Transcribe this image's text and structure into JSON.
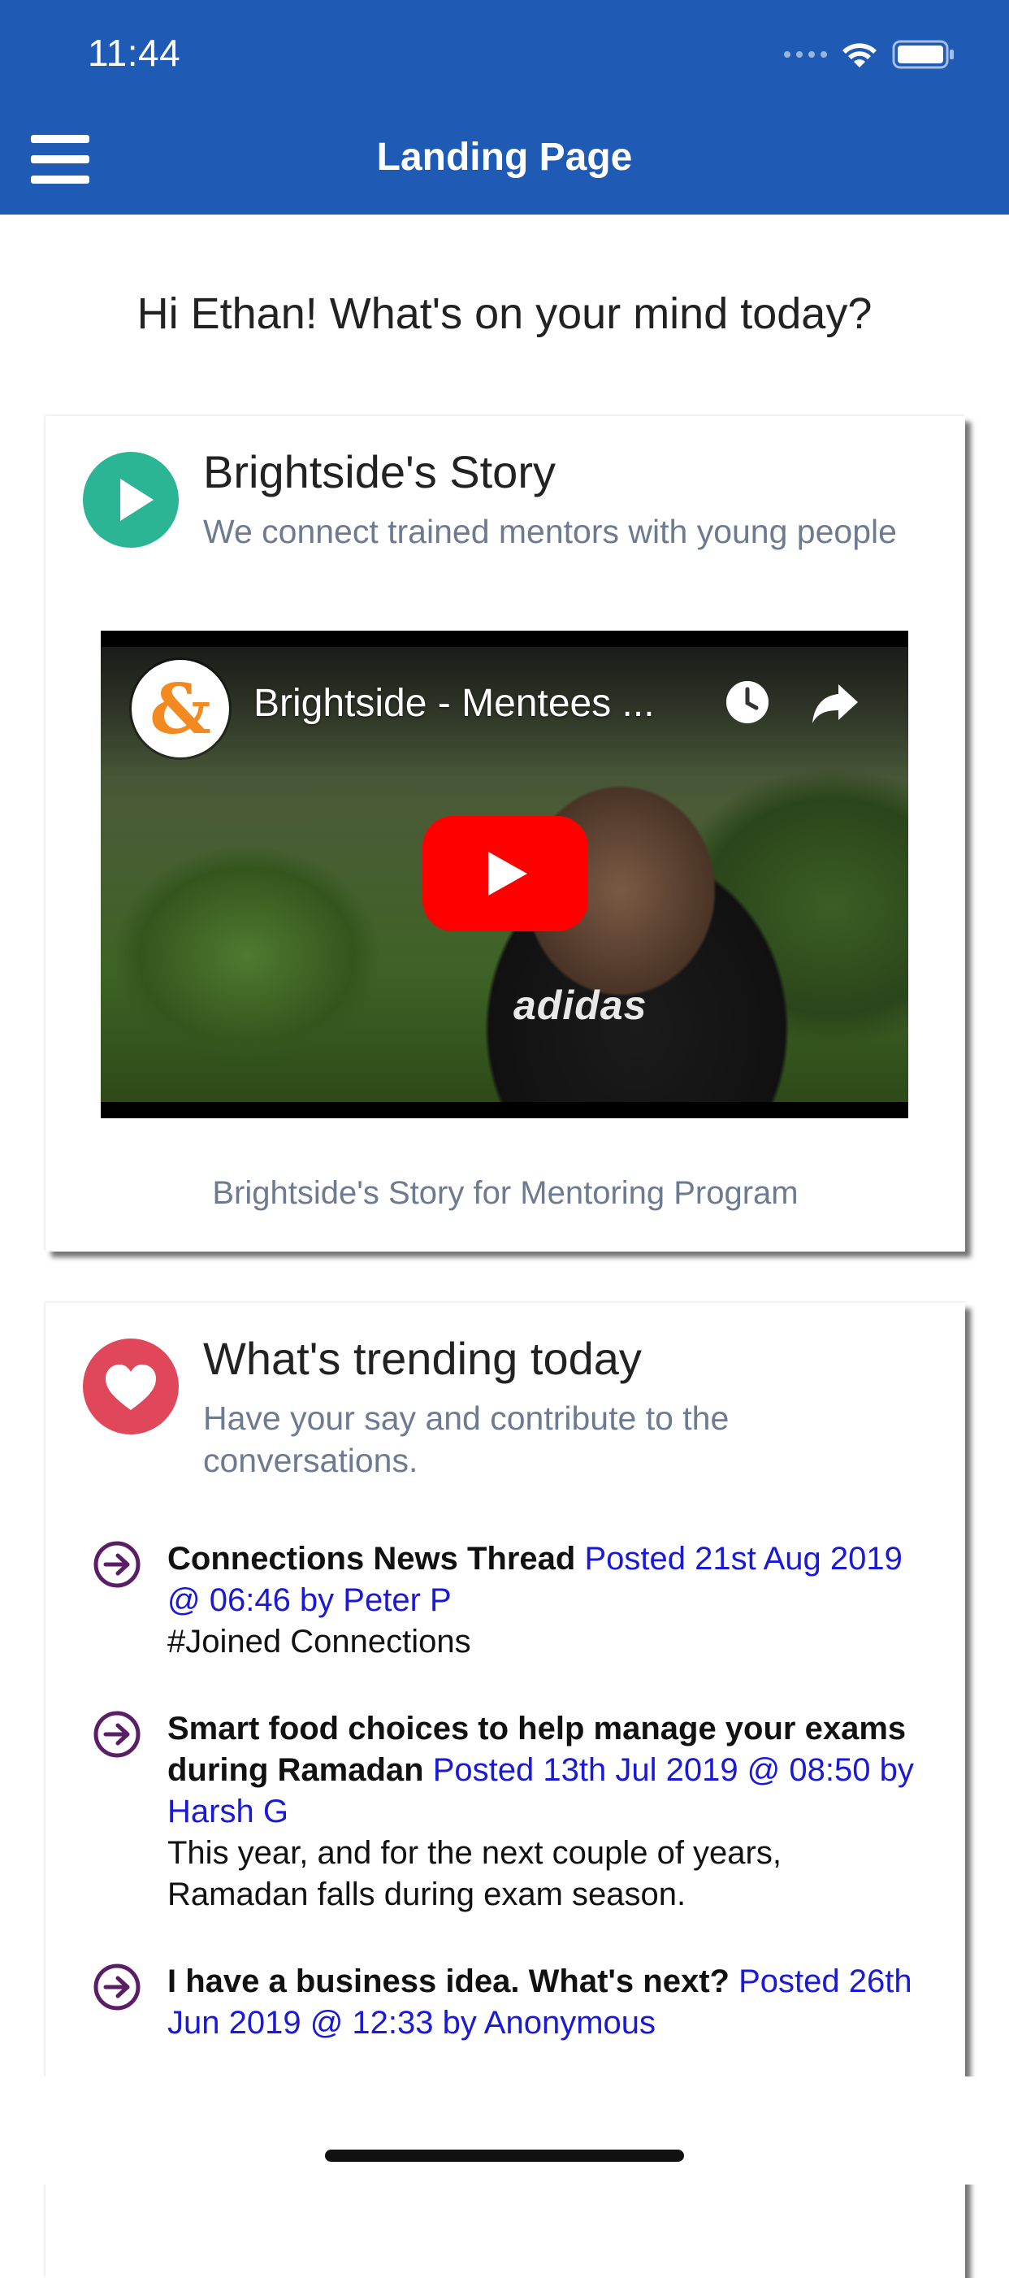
{
  "status_bar": {
    "time": "11:44"
  },
  "header": {
    "title": "Landing Page",
    "menu_icon": "hamburger-menu-icon",
    "background": "#1f5bb4"
  },
  "greeting": "Hi Ethan! What's on your mind today?",
  "story_card": {
    "title": "Brightside's Story",
    "subtitle": "We connect trained mentors with young people",
    "icon": "play-circle-icon",
    "icon_color": "#2bb594",
    "video": {
      "title": "Brightside - Mentees ...",
      "channel_logo_text": "&",
      "shirt_text": "adidas"
    },
    "caption": "Brightside's Story for Mentoring Program"
  },
  "trending_card": {
    "title": "What's trending today",
    "subtitle": "Have your say and contribute to the conversations.",
    "icon": "heart-circle-icon",
    "icon_color": "#e0475a",
    "items": [
      {
        "title": "Connections News Thread",
        "meta": "Posted 21st Aug 2019 @ 06:46 by Peter P",
        "body": "#Joined Connections"
      },
      {
        "title": "Smart food choices to help manage your exams during Ramadan",
        "meta": "Posted 13th Jul 2019 @ 08:50 by Harsh G",
        "body": "This year, and for the next couple of years, Ramadan falls during exam season."
      },
      {
        "title": "I have a business idea. What's next?",
        "meta": "Posted 26th Jun 2019 @ 12:33 by Anonymous",
        "body": ""
      }
    ]
  }
}
